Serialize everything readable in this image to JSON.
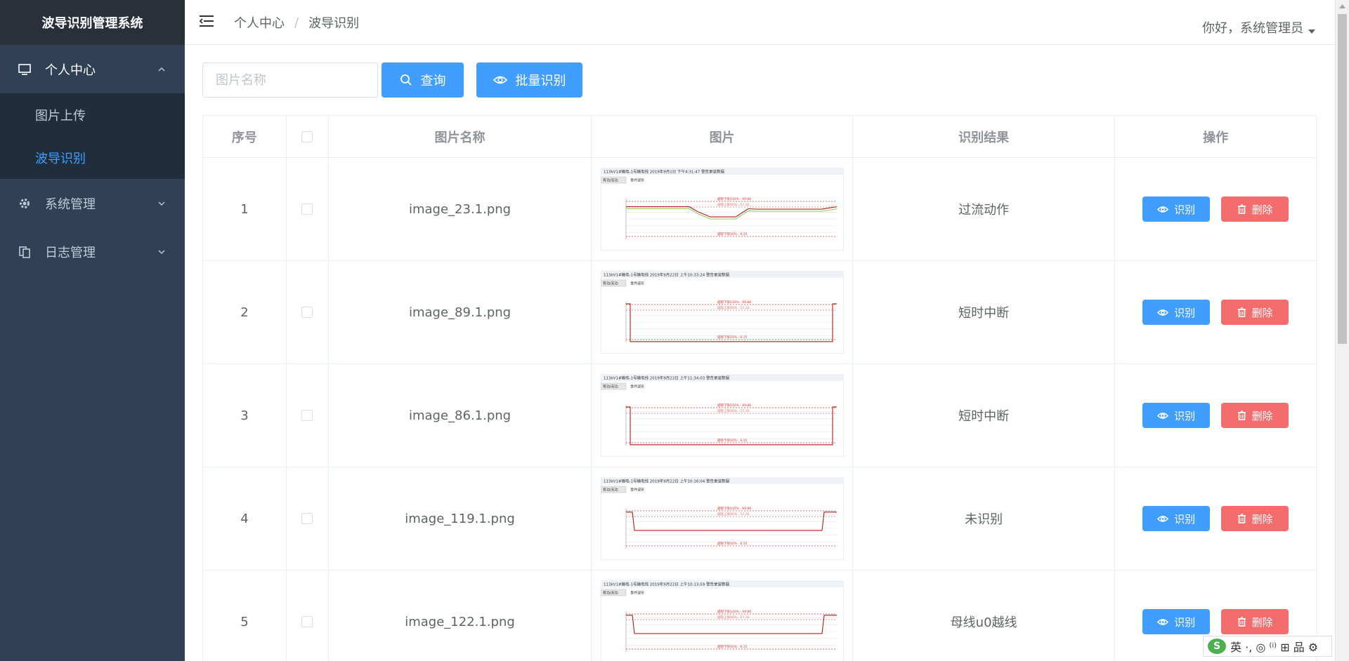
{
  "app": {
    "title": "波导识别管理系统"
  },
  "sidebar": {
    "groups": [
      {
        "label": "个人中心",
        "icon": "monitor-icon",
        "expanded": true,
        "items": [
          {
            "label": "图片上传",
            "active": false
          },
          {
            "label": "波导识别",
            "active": true
          }
        ]
      },
      {
        "label": "系统管理",
        "icon": "gear-icon",
        "expanded": false
      },
      {
        "label": "日志管理",
        "icon": "documents-icon",
        "expanded": false
      }
    ]
  },
  "header": {
    "breadcrumb": [
      "个人中心",
      "波导识别"
    ],
    "breadcrumb_separator": "/",
    "greeting": "你好，系统管理员"
  },
  "toolbar": {
    "search_placeholder": "图片名称",
    "query_label": "查询",
    "batch_label": "批量识别"
  },
  "table": {
    "columns": [
      "序号",
      "",
      "图片名称",
      "图片",
      "识别结果",
      "操作"
    ],
    "action_labels": {
      "recognize": "识别",
      "delete": "删除"
    },
    "rows": [
      {
        "index": "1",
        "name": "image_23.1.png",
        "result": "过流动作",
        "chart": {
          "title": "113kV1#输电-1号输电线 2019年9月1日 下午4:31:47 警告录波数据",
          "toolbar": [
            "有功/无功",
            "事件波形"
          ],
          "upper": "越限下限110% - 69.86",
          "limit": "越限上限90% - 57.16",
          "lower": "越限下限10% - 6.35"
        }
      },
      {
        "index": "2",
        "name": "image_89.1.png",
        "result": "短时中断",
        "chart": {
          "title": "113kV1#输电-1号输电线 2019年9月22日 上午10:33:24 警告录波数据",
          "toolbar": [
            "有功/无功",
            "事件波形"
          ],
          "upper": "越限下限110% - 69.86",
          "limit": "越限上限90% - 57.16",
          "lower": "越限下限10% - 6.35"
        }
      },
      {
        "index": "3",
        "name": "image_86.1.png",
        "result": "短时中断",
        "chart": {
          "title": "113kV1#输电-1号输电线 2019年9月22日 上午11:34:03 警告录波数据",
          "toolbar": [
            "有功/无功",
            "事件波形"
          ],
          "upper": "越限下限110% - 69.86",
          "limit": "越限上限90% - 57.16",
          "lower": "越限下限10% - 6.35"
        }
      },
      {
        "index": "4",
        "name": "image_119.1.png",
        "result": "未识别",
        "chart": {
          "title": "113kV1#输电-1号输电线 2019年9月22日 上午10:16:04 警告录波数据",
          "toolbar": [
            "有功/无功",
            "事件波形"
          ],
          "upper": "越限下限110% - 69.86",
          "limit": "越限上限90% - 57.16",
          "lower": "越限下限10% - 6.35"
        }
      },
      {
        "index": "5",
        "name": "image_122.1.png",
        "result": "母线u0越线",
        "chart": {
          "title": "113kV1#输电-1号输电线 2019年9月22日 上午10:13:59 警告录波数据",
          "toolbar": [
            "有功/无功",
            "事件波形"
          ],
          "upper": "越限下限110% - 69.86",
          "limit": "越限上限90% - 57.16",
          "lower": "越限下限10% - 6.35"
        }
      }
    ]
  },
  "ime": {
    "text": "英 ·, ◎ ⁽ⁱ⁾ ⊞ 品 ⚙",
    "logo": "S"
  },
  "colors": {
    "primary": "#409eff",
    "danger": "#f56c6c",
    "sidebar": "#304156",
    "sidebar_sub": "#1f2d3d",
    "active": "#409eff"
  }
}
